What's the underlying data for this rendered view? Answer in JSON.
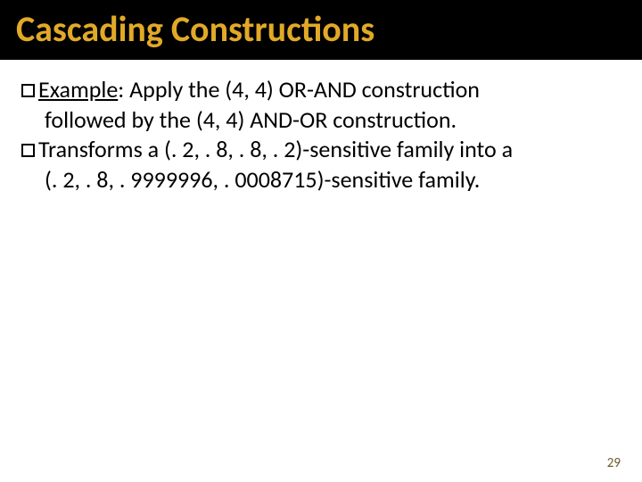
{
  "title": "Cascading Constructions",
  "body": {
    "line1_label": "Example",
    "line1_after": ": Apply the (4, 4) OR-AND construction",
    "line2": "followed by the (4, 4) AND-OR construction.",
    "line3": "Transforms a (. 2, . 8, . 8, . 2)-sensitive family into a",
    "line4": "(. 2, . 8, . 9999996, . 0008715)-sensitive family."
  },
  "page_number": "29"
}
